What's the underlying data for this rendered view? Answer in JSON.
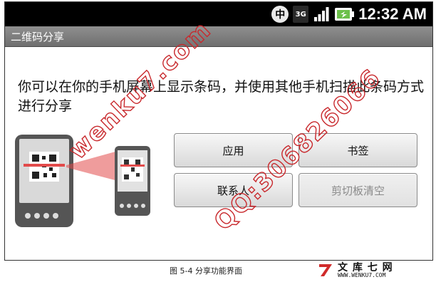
{
  "status_bar": {
    "icons": [
      "zh-input-icon",
      "3g-icon",
      "signal-icon",
      "battery-icon"
    ],
    "zh_label": "中",
    "network_label": "3G",
    "time": "12:32 AM"
  },
  "title_bar": {
    "title": "二维码分享"
  },
  "instruction": "你可以在你的手机屏幕上显示条码，并使用其他手机扫描此条码方式进行分享",
  "buttons": {
    "app": "应用",
    "bookmark": "书签",
    "contacts": "联系人",
    "clipboard": "剪切板清空"
  },
  "watermarks": {
    "site": "wenku7.com",
    "qq": "QQ:306826066"
  },
  "caption": "图 5-4 分享功能界面",
  "logo": {
    "cn": "文 库 七 网",
    "url": "WWW.WENKU7.COM"
  },
  "colors": {
    "title_bar": "#7f7f7f",
    "status_bar": "#000000",
    "watermark": "#c8282c",
    "scan_beam": "#e24a4a"
  }
}
